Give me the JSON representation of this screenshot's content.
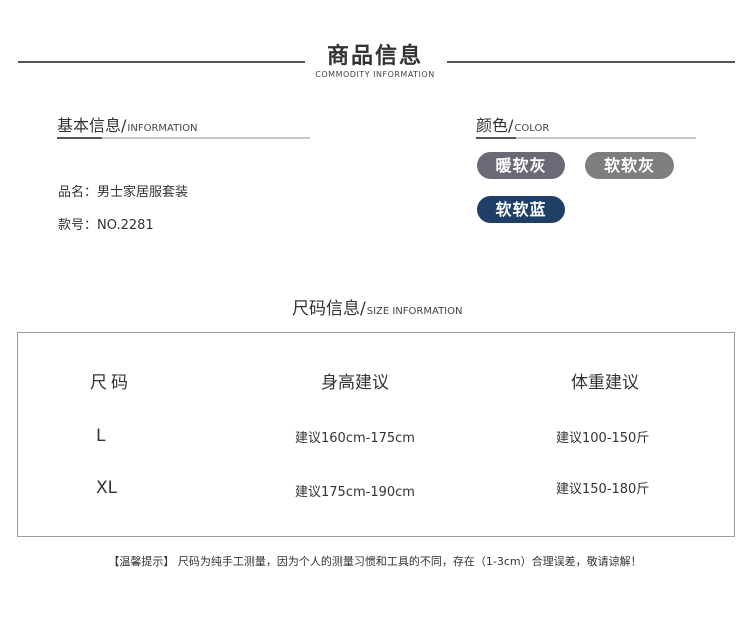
{
  "header": {
    "title": "商品信息",
    "subtitle": "COMMODITY INFORMATION"
  },
  "basic_info": {
    "heading": "基本信息/",
    "heading_en": "INFORMATION",
    "name_label": "品名：",
    "name_value": "男士家居服套装",
    "model_label": "款号：",
    "model_value": "NO.2281"
  },
  "color": {
    "heading": "颜色/",
    "heading_en": "COLOR",
    "swatches": [
      {
        "label": "暖软灰",
        "color": "#6a6a76"
      },
      {
        "label": "软软灰",
        "color": "#7e7e7e"
      },
      {
        "label": "软软蓝",
        "color": "#1f3f66"
      }
    ]
  },
  "size_info": {
    "heading": "尺码信息/",
    "heading_en": "SIZE INFORMATION",
    "columns": [
      "尺码",
      "身高建议",
      "体重建议"
    ],
    "rows": [
      {
        "size": "L",
        "height": "建议160cm-175cm",
        "weight": "建议100-150斤"
      },
      {
        "size": "XL",
        "height": "建议175cm-190cm",
        "weight": "建议150-180斤"
      }
    ]
  },
  "note": "【温馨提示】 尺码为纯手工测量，因为个人的测量习惯和工具的不同，存在（1-3cm）合理误差，敬请谅解！"
}
